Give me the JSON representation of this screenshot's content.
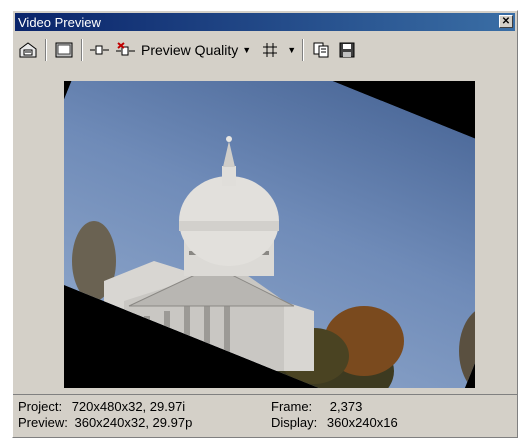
{
  "window": {
    "title": "Video Preview"
  },
  "toolbar": {
    "preview_quality_label": "Preview Quality",
    "icons": [
      "properties-icon",
      "preview-device-icon",
      "split-icon",
      "split-remove-icon",
      "grid-icon",
      "copy-icon",
      "save-icon"
    ]
  },
  "status": {
    "project_label": "Project:",
    "project_value": "720x480x32, 29.97i",
    "preview_label": "Preview:",
    "preview_value": "360x240x32, 29.97p",
    "frame_label": "Frame:",
    "frame_value": "2,373",
    "display_label": "Display:",
    "display_value": "360x240x16"
  }
}
